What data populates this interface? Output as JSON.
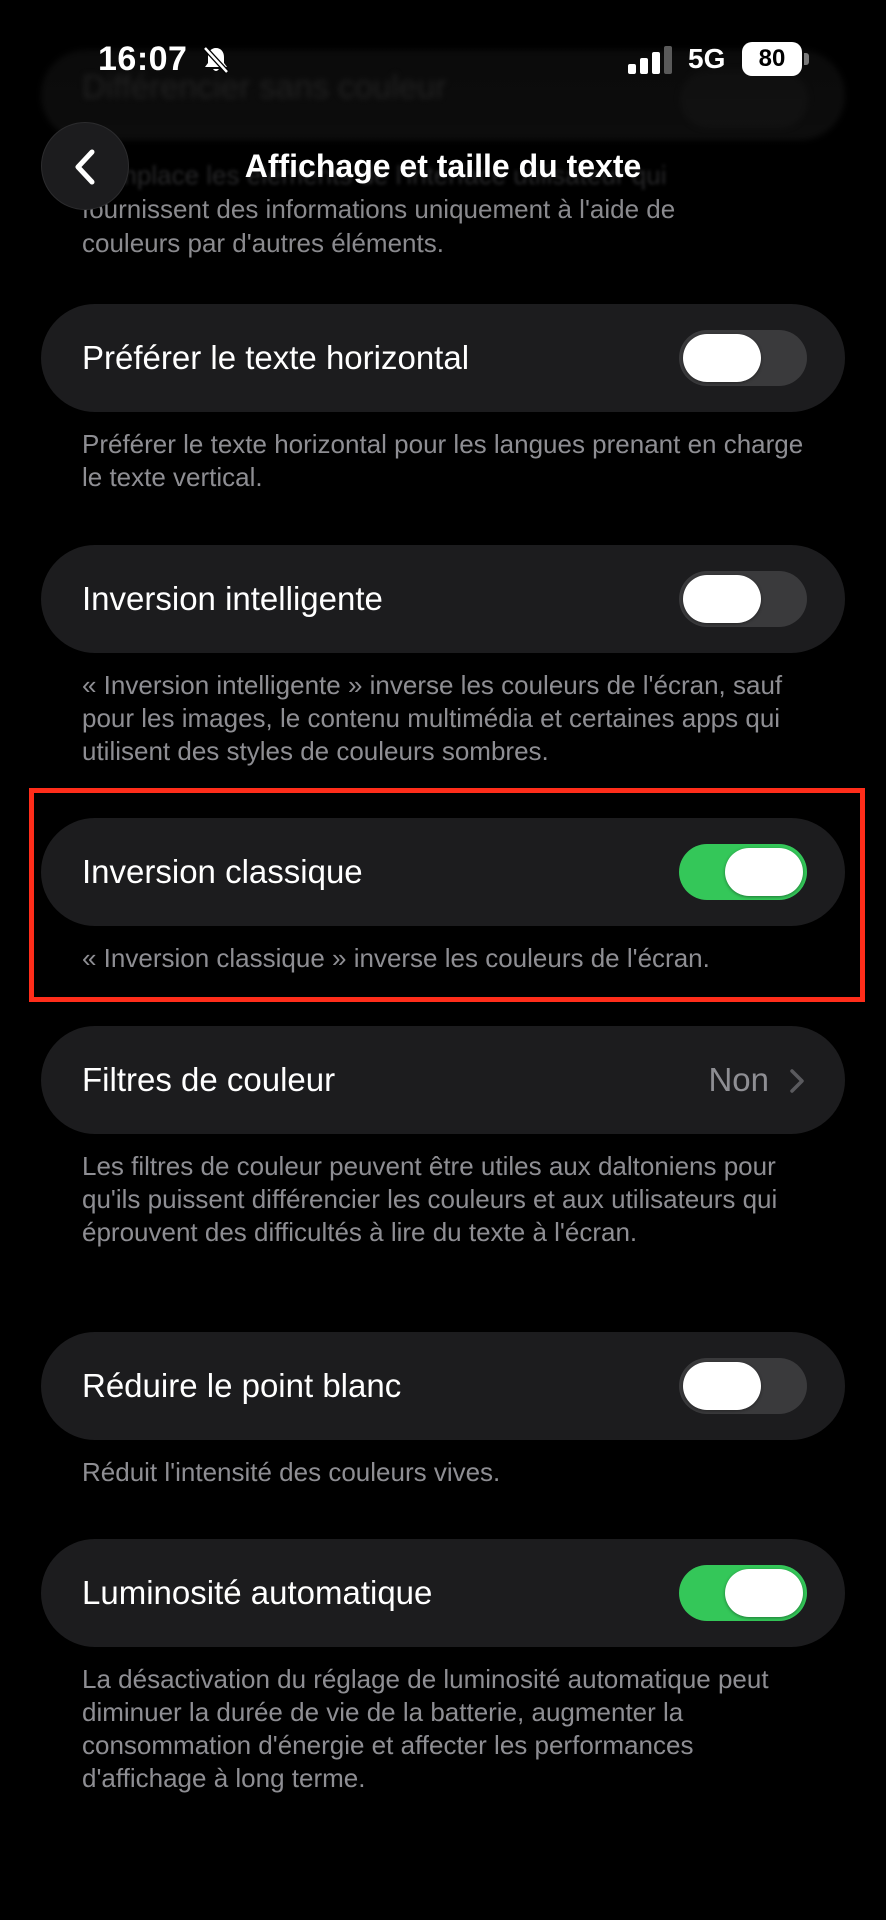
{
  "status_bar": {
    "time": "16:07",
    "network": "5G",
    "battery": "80"
  },
  "ghost": {
    "label": "Différencier sans couleur",
    "desc_line1": "Remplace les éléments de l'interface utilisateur qui",
    "desc_line2": "fournissent des informations uniquement à l'aide de",
    "desc_line3": "couleurs par d'autres éléments."
  },
  "nav": {
    "back_icon": "chevron-left-icon",
    "title": "Affichage et taille du texte"
  },
  "settings": [
    {
      "label": "Préférer le texte horizontal",
      "toggle": false,
      "description": "Préférer le texte horizontal pour les langues prenant en charge le texte vertical."
    },
    {
      "label": "Inversion intelligente",
      "toggle": false,
      "description": "« Inversion intelligente » inverse les couleurs de l'écran, sauf pour les images, le contenu multimédia et certaines apps qui utilisent des styles de couleurs sombres."
    },
    {
      "label": "Inversion classique",
      "toggle": true,
      "description": "« Inversion classique » inverse les couleurs de l'écran."
    },
    {
      "label": "Filtres de couleur",
      "value": "Non",
      "description": "Les filtres de couleur peuvent être utiles aux daltoniens pour qu'ils puissent différencier les couleurs et aux utilisateurs qui éprouvent des difficultés à lire du texte à l'écran."
    },
    {
      "label": "Réduire le point blanc",
      "toggle": false,
      "description": "Réduit l'intensité des couleurs vives."
    },
    {
      "label": "Luminosité automatique",
      "toggle": true,
      "description": "La désactivation du réglage de luminosité automatique peut diminuer la durée de vie de la batterie, augmenter la consommation d'énergie et affecter les performances d'affichage à long terme."
    }
  ],
  "colors": {
    "background": "#000000",
    "cell": "#1c1c1e",
    "toggle_on": "#34c759",
    "toggle_off": "#3a3a3c",
    "secondary_text": "#8e8e93",
    "highlight": "#ff2d1a"
  }
}
